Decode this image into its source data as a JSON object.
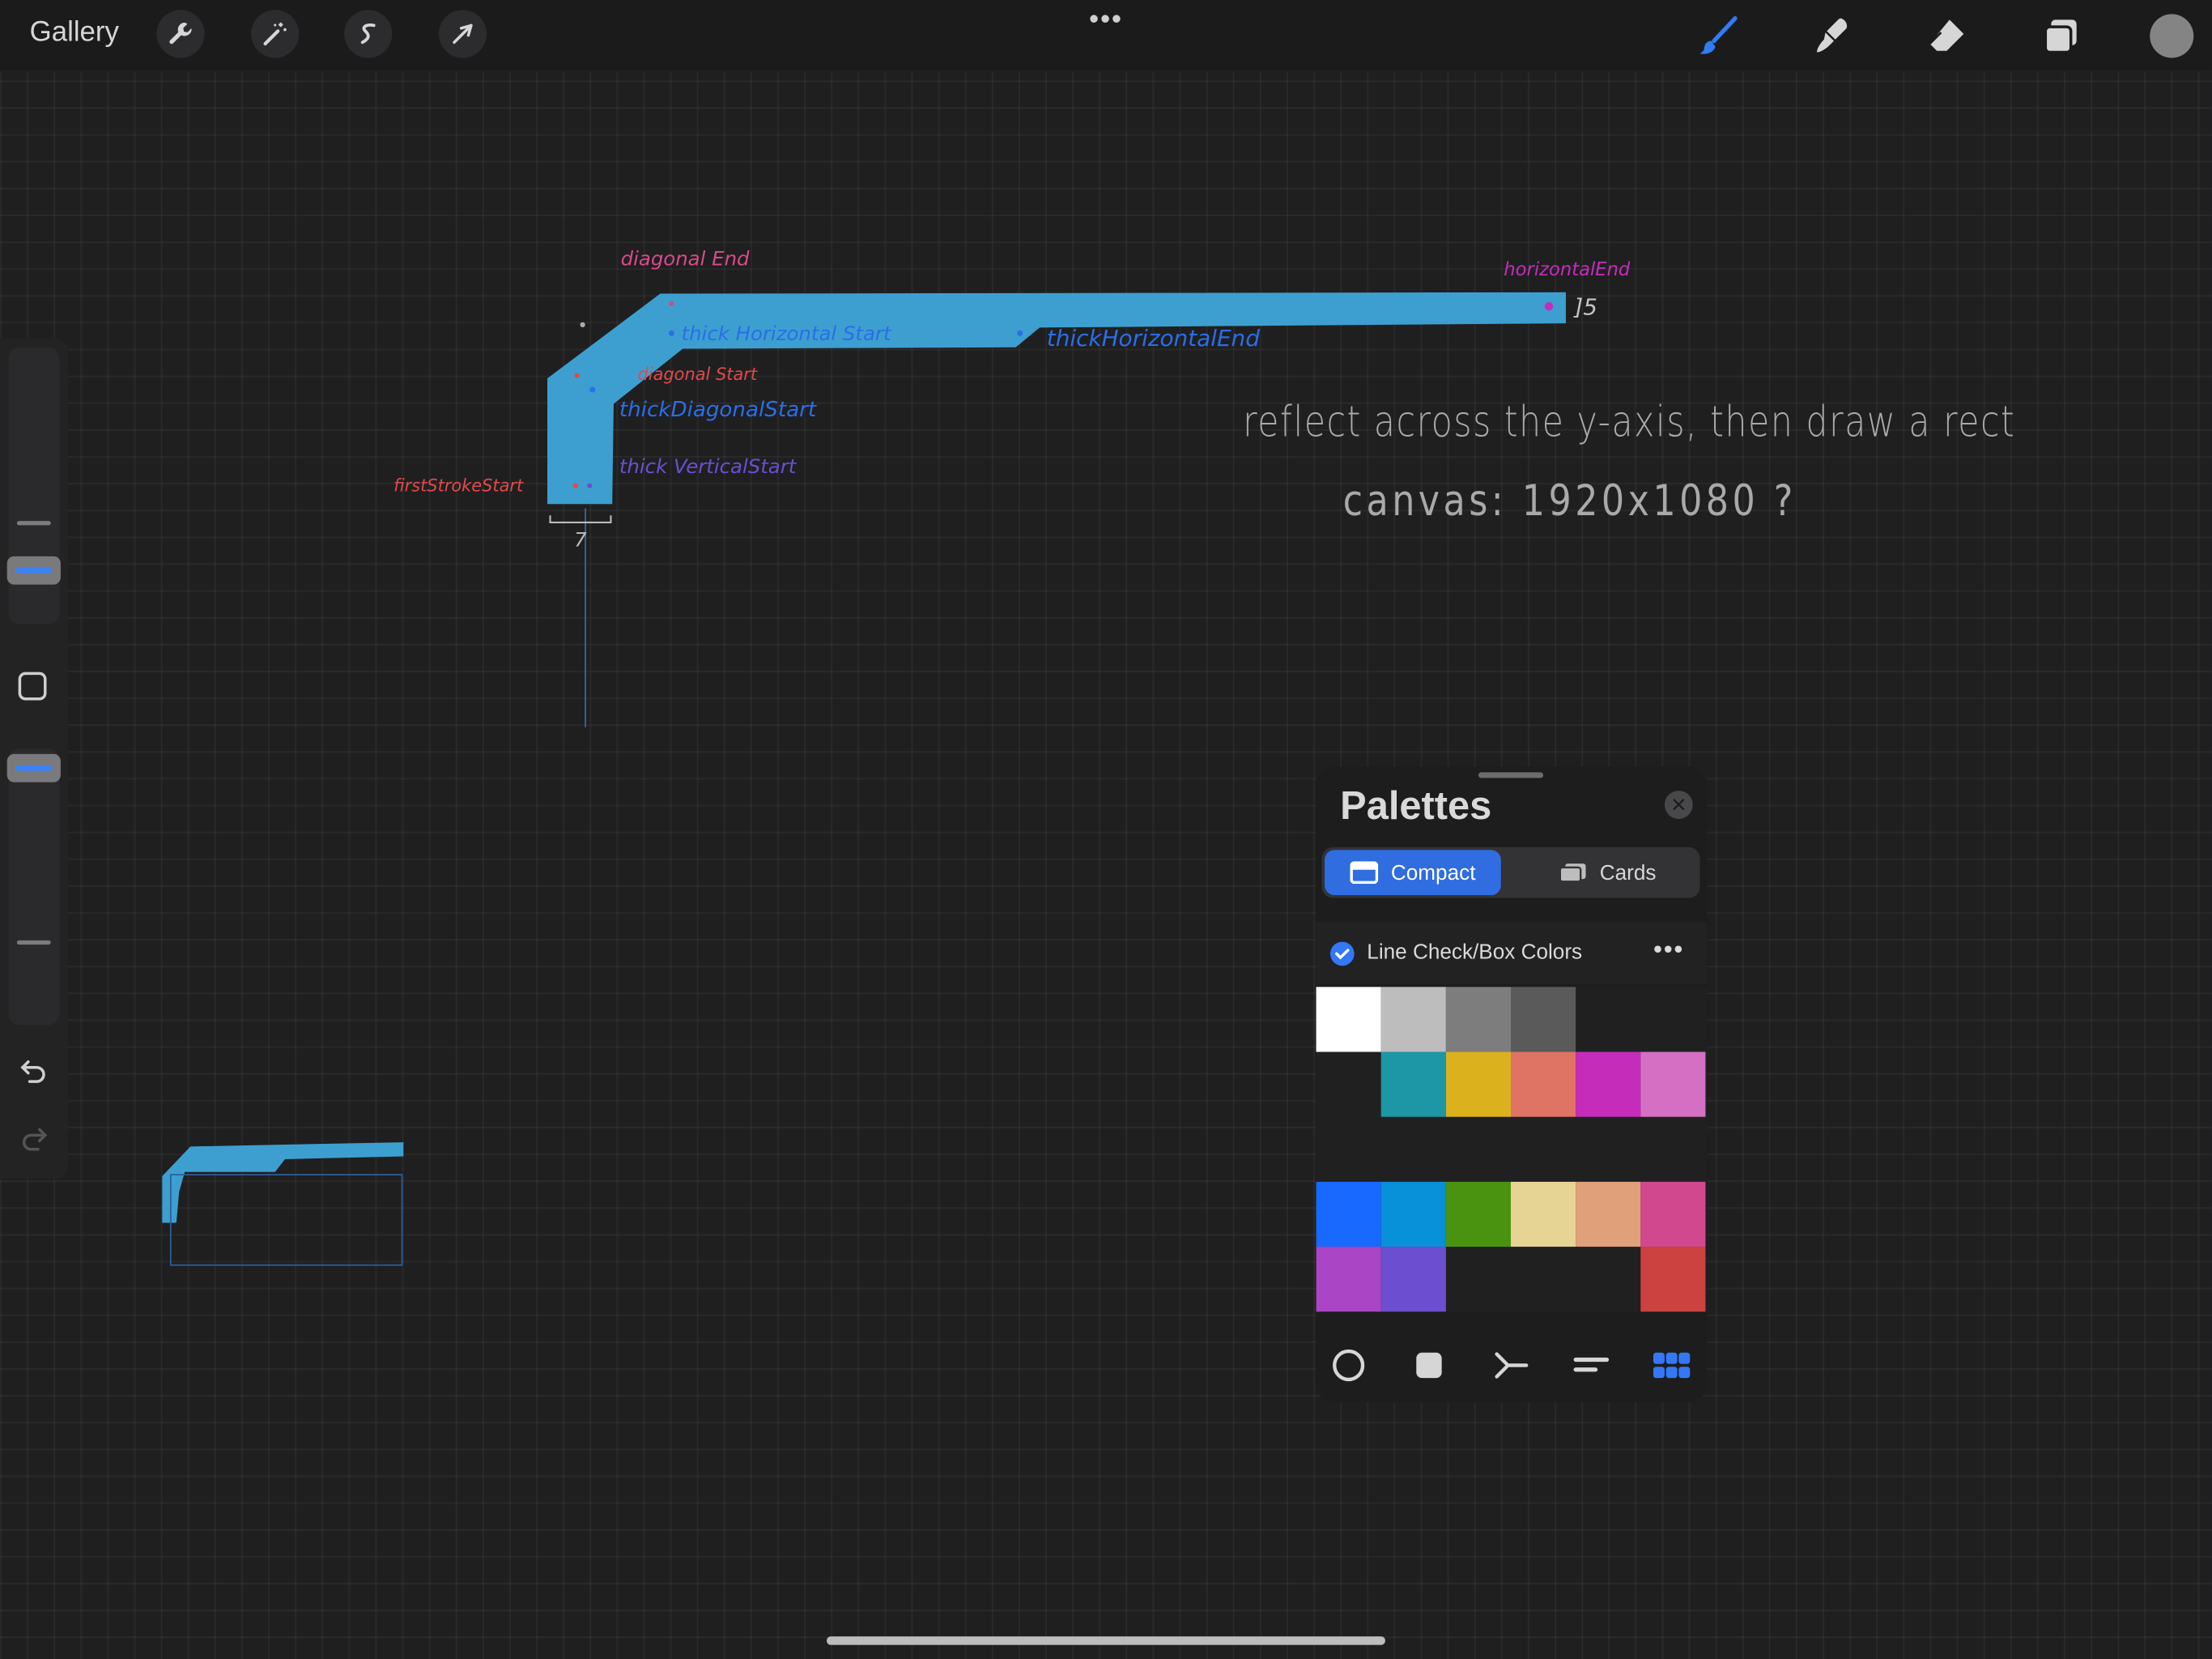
{
  "topbar": {
    "gallery_label": "Gallery",
    "actions_icon": "wrench-icon",
    "adjustments_icon": "magic-wand-icon",
    "selection_icon": "selection-s-icon",
    "transform_icon": "arrow-cursor-icon",
    "more_icon": "ellipsis-icon",
    "brush_icon": "brush-icon",
    "smudge_icon": "smudge-icon",
    "eraser_icon": "eraser-icon",
    "layers_icon": "layers-icon",
    "current_color": "#848484"
  },
  "sidebar": {
    "brush_size_icon": "slider-knob",
    "modify_icon": "square-icon",
    "opacity_icon": "slider-knob",
    "undo_icon": "undo-icon",
    "redo_icon": "redo-icon"
  },
  "canvas": {
    "annotations": {
      "diagonal_end": "diagonal End",
      "horizontal_end": "horizontalEnd",
      "five": "]5",
      "thick_horizontal_start": "thick Horizontal Start",
      "thick_horizontal_end": "thickHorizontalEnd",
      "diagonal_start": "diagonal Start",
      "thick_diagonal_start": "thickDiagonalStart",
      "thick_vertical_start": "thick VerticalStart",
      "first_stroke_start": "firstStrokeStart",
      "seven": "7"
    },
    "note_line1": "reflect across the y-axis, then draw a rect",
    "note_line2": "canvas: 1920x1080 ?",
    "stroke_color": "#3d9fd0"
  },
  "palettes": {
    "title": "Palettes",
    "close_icon": "close-icon",
    "tabs": [
      {
        "label": "Compact",
        "icon": "compact-icon",
        "active": true
      },
      {
        "label": "Cards",
        "icon": "cards-icon",
        "active": false
      }
    ],
    "palette_name": "Line Check/Box Colors",
    "more_icon": "ellipsis-icon",
    "swatch_rows": [
      [
        "#ffffff",
        "#bdbdbd",
        "#7d7d7d",
        "#5a5a5a",
        null,
        null
      ],
      [
        null,
        "#1d97a6",
        "#dbb21e",
        "#df7364",
        "#c52cba",
        "#d56fc4"
      ],
      [
        null,
        null,
        null,
        null,
        null,
        null
      ],
      [
        "#1769ff",
        "#0890d8",
        "#4a9311",
        "#e6d495",
        "#e0a07a",
        "#d2488e"
      ],
      [
        "#aa45c5",
        "#6b4fd0",
        null,
        null,
        null,
        "#cb4240"
      ]
    ],
    "bottom_modes": [
      "disc-icon",
      "classic-icon",
      "harmony-icon",
      "value-icon",
      "palettes-grid-icon"
    ]
  }
}
